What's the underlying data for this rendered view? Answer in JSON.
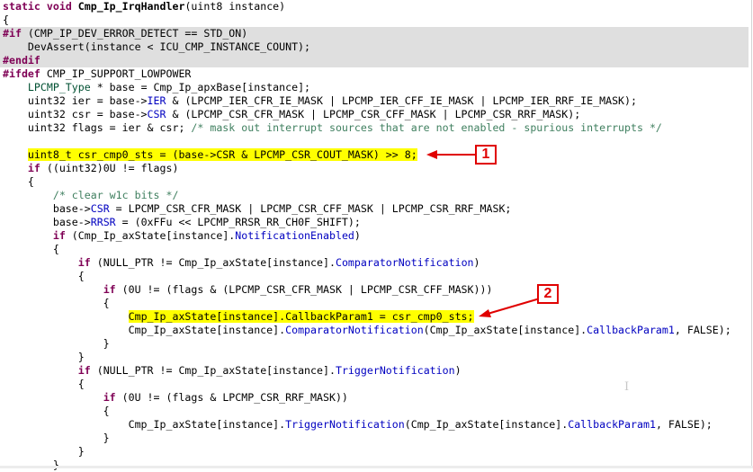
{
  "code": {
    "lines": [
      {
        "tokens": [
          [
            "k",
            "static"
          ],
          [
            "t",
            " "
          ],
          [
            "k",
            "void"
          ],
          [
            "t",
            " "
          ],
          [
            "b",
            "Cmp_Ip_IrqHandler"
          ],
          [
            "t",
            "(uint8 instance)"
          ]
        ]
      },
      {
        "tokens": [
          [
            "t",
            "{"
          ]
        ]
      },
      {
        "bg": "pp",
        "tokens": [
          [
            "p",
            "#if"
          ],
          [
            "t",
            " (CMP_IP_DEV_ERROR_DETECT == STD_ON)"
          ]
        ]
      },
      {
        "bg": "pp",
        "tokens": [
          [
            "t",
            "    DevAssert(instance < ICU_CMP_INSTANCE_COUNT);"
          ]
        ]
      },
      {
        "bg": "pp",
        "tokens": [
          [
            "p",
            "#endif"
          ]
        ]
      },
      {
        "tokens": [
          [
            "p",
            "#ifdef"
          ],
          [
            "t",
            " CMP_IP_SUPPORT_LOWPOWER"
          ]
        ]
      },
      {
        "tokens": [
          [
            "t",
            "    "
          ],
          [
            "y",
            "LPCMP_Type"
          ],
          [
            "t",
            " * base = Cmp_Ip_apxBase[instance];"
          ]
        ]
      },
      {
        "tokens": [
          [
            "t",
            "    uint32 ier = base->"
          ],
          [
            "f",
            "IER"
          ],
          [
            "t",
            " & (LPCMP_IER_CFR_IE_MASK | LPCMP_IER_CFF_IE_MASK | LPCMP_IER_RRF_IE_MASK);"
          ]
        ]
      },
      {
        "tokens": [
          [
            "t",
            "    uint32 csr = base->"
          ],
          [
            "f",
            "CSR"
          ],
          [
            "t",
            " & (LPCMP_CSR_CFR_MASK | LPCMP_CSR_CFF_MASK | LPCMP_CSR_RRF_MASK);"
          ]
        ]
      },
      {
        "tokens": [
          [
            "t",
            "    uint32 flags = ier & csr; "
          ],
          [
            "c",
            "/* mask out interrupt sources that are not enabled - spurious interrupts */"
          ]
        ]
      },
      {
        "tokens": []
      },
      {
        "hl": 4,
        "tokens": [
          [
            "t",
            "    "
          ],
          [
            "t",
            "uint8_t csr_cmp0_sts = (base->CSR & LPCMP_CSR_COUT_MASK) >> 8;"
          ]
        ]
      },
      {
        "tokens": [
          [
            "t",
            "    "
          ],
          [
            "k",
            "if"
          ],
          [
            "t",
            " ((uint32)0U != flags)"
          ]
        ]
      },
      {
        "tokens": [
          [
            "t",
            "    {"
          ]
        ]
      },
      {
        "tokens": [
          [
            "t",
            "        "
          ],
          [
            "c",
            "/* clear w1c bits */"
          ]
        ]
      },
      {
        "tokens": [
          [
            "t",
            "        base->"
          ],
          [
            "f",
            "CSR"
          ],
          [
            "t",
            " = LPCMP_CSR_CFR_MASK | LPCMP_CSR_CFF_MASK | LPCMP_CSR_RRF_MASK;"
          ]
        ]
      },
      {
        "tokens": [
          [
            "t",
            "        base->"
          ],
          [
            "f",
            "RRSR"
          ],
          [
            "t",
            " = (0xFFu << LPCMP_RRSR_RR_CH0F_SHIFT);"
          ]
        ]
      },
      {
        "tokens": [
          [
            "t",
            "        "
          ],
          [
            "k",
            "if"
          ],
          [
            "t",
            " (Cmp_Ip_axState[instance]."
          ],
          [
            "f",
            "NotificationEnabled"
          ],
          [
            "t",
            ")"
          ]
        ]
      },
      {
        "tokens": [
          [
            "t",
            "        {"
          ]
        ]
      },
      {
        "tokens": [
          [
            "t",
            "            "
          ],
          [
            "k",
            "if"
          ],
          [
            "t",
            " (NULL_PTR != Cmp_Ip_axState[instance]."
          ],
          [
            "f",
            "ComparatorNotification"
          ],
          [
            "t",
            ")"
          ]
        ]
      },
      {
        "tokens": [
          [
            "t",
            "            {"
          ]
        ]
      },
      {
        "tokens": [
          [
            "t",
            "                "
          ],
          [
            "k",
            "if"
          ],
          [
            "t",
            " (0U != (flags & (LPCMP_CSR_CFR_MASK | LPCMP_CSR_CFF_MASK)))"
          ]
        ]
      },
      {
        "tokens": [
          [
            "t",
            "                {"
          ]
        ]
      },
      {
        "hl": 20,
        "tokens": [
          [
            "t",
            "                    "
          ],
          [
            "t",
            "Cmp_Ip_axState[instance].CallbackParam1 = csr_cmp0_sts;"
          ]
        ]
      },
      {
        "tokens": [
          [
            "t",
            "                    Cmp_Ip_axState[instance]."
          ],
          [
            "f",
            "ComparatorNotification"
          ],
          [
            "t",
            "(Cmp_Ip_axState[instance]."
          ],
          [
            "f",
            "CallbackParam1"
          ],
          [
            "t",
            ", FALSE);"
          ]
        ]
      },
      {
        "tokens": [
          [
            "t",
            "                }"
          ]
        ]
      },
      {
        "tokens": [
          [
            "t",
            "            }"
          ]
        ]
      },
      {
        "tokens": [
          [
            "t",
            "            "
          ],
          [
            "k",
            "if"
          ],
          [
            "t",
            " (NULL_PTR != Cmp_Ip_axState[instance]."
          ],
          [
            "f",
            "TriggerNotification"
          ],
          [
            "t",
            ")"
          ]
        ]
      },
      {
        "tokens": [
          [
            "t",
            "            {"
          ]
        ]
      },
      {
        "tokens": [
          [
            "t",
            "                "
          ],
          [
            "k",
            "if"
          ],
          [
            "t",
            " (0U != (flags & LPCMP_CSR_RRF_MASK))"
          ]
        ]
      },
      {
        "tokens": [
          [
            "t",
            "                {"
          ]
        ]
      },
      {
        "tokens": [
          [
            "t",
            "                    Cmp_Ip_axState[instance]."
          ],
          [
            "f",
            "TriggerNotification"
          ],
          [
            "t",
            "(Cmp_Ip_axState[instance]."
          ],
          [
            "f",
            "CallbackParam1"
          ],
          [
            "t",
            ", FALSE);"
          ]
        ]
      },
      {
        "tokens": [
          [
            "t",
            "                }"
          ]
        ]
      },
      {
        "tokens": [
          [
            "t",
            "            }"
          ]
        ]
      },
      {
        "tokens": [
          [
            "t",
            "        }"
          ]
        ]
      }
    ]
  },
  "annotations": {
    "callout1": "1",
    "callout2": "2",
    "color": "#e00000"
  },
  "colors": {
    "keyword": "#7f0055",
    "field": "#0000c0",
    "comment": "#3f7f5f",
    "highlight": "#ffff00",
    "inactive_bg": "#dfdfdf"
  }
}
